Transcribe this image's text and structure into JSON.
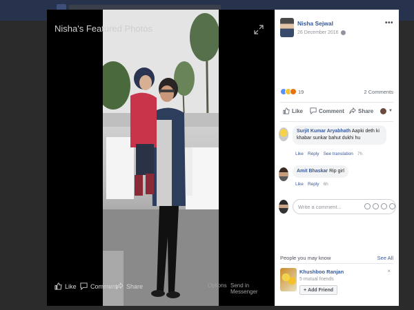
{
  "viewer": {
    "title": "Nisha's Featured Photos",
    "actions": {
      "like": "Like",
      "comment": "Comment",
      "share": "Share",
      "options": "Options",
      "send": "Send in Messenger"
    }
  },
  "post": {
    "author": "Nisha Sejwal",
    "date": "26 December 2016",
    "reactions_count": "19",
    "comments_link": "2 Comments",
    "actions": {
      "like": "Like",
      "comment": "Comment",
      "share": "Share"
    }
  },
  "comments": [
    {
      "name": "Surjit Kumar Aryabhath",
      "text": "Aapki deth ki khabar sunkar bahut dukhi hu",
      "like": "Like",
      "reply": "Reply",
      "translate": "See translation",
      "time": "7h"
    },
    {
      "name": "Amit Bhaskar",
      "text": "Rip girl",
      "like": "Like",
      "reply": "Reply",
      "time": "6h"
    }
  ],
  "write_comment": {
    "placeholder": "Write a comment..."
  },
  "pymk": {
    "header": "People you may know",
    "see_all": "See All",
    "person": {
      "name": "Khushboo Ranjan",
      "mutual": "5 mutual friends",
      "add_label": "Add Friend"
    }
  },
  "colors": {
    "link_blue": "#365899",
    "fb_header": "#27334d",
    "like_blue": "#5890ff"
  }
}
